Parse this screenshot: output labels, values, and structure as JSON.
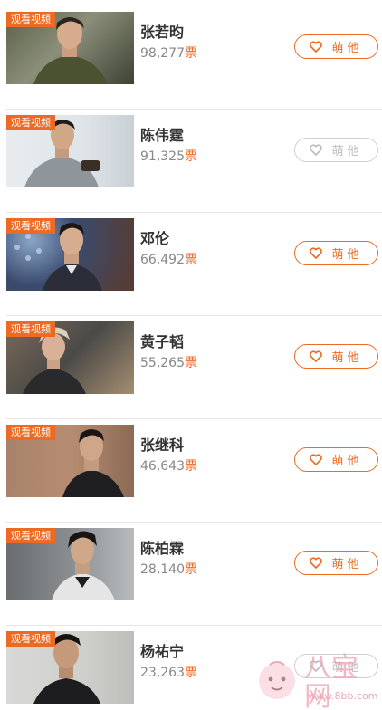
{
  "badge_text": "观看视频",
  "vote_unit": "票",
  "like_label": "萌他",
  "accent_color": "#ec6a22",
  "icons": {
    "like": "heart-outline-icon"
  },
  "items": [
    {
      "name": "张若昀",
      "votes": "98,277",
      "liked": true
    },
    {
      "name": "陈伟霆",
      "votes": "91,325",
      "liked": false
    },
    {
      "name": "邓伦",
      "votes": "66,492",
      "liked": true
    },
    {
      "name": "黄子韬",
      "votes": "55,265",
      "liked": true
    },
    {
      "name": "张继科",
      "votes": "46,643",
      "liked": true
    },
    {
      "name": "陈柏霖",
      "votes": "28,140",
      "liked": true
    },
    {
      "name": "杨祐宁",
      "votes": "23,263",
      "liked": false
    }
  ],
  "watermark": {
    "title": "八宝网",
    "url": "www.8bb.com"
  }
}
